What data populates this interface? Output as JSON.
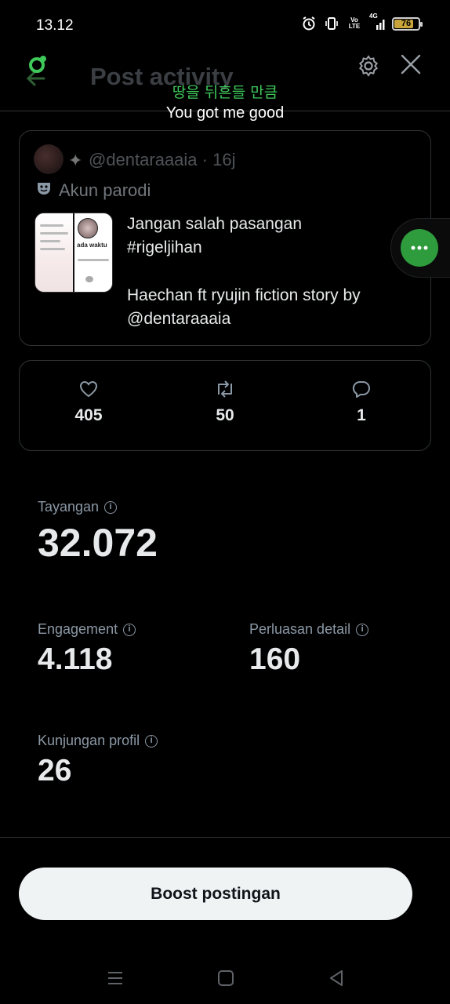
{
  "status_bar": {
    "time": "13.12",
    "volte_label": "Vo\nLTE",
    "network_label": "4G",
    "battery_level": "76",
    "battery_fraction": 0.76
  },
  "header": {
    "title": "Post activity"
  },
  "lyrics": {
    "korean": "땅을 뒤흔들 만큼",
    "english": "You got me good"
  },
  "post": {
    "handle": "@dentaraaaia · 16j",
    "parody_label": "Akun parodi",
    "text_line1": "Jangan salah pasangan",
    "text_line2": "#rigeljihan",
    "text_line3": "Haechan ft ryujin fiction story by",
    "text_line4": "@dentaraaaia",
    "thumbnail_caption": "ada waktu"
  },
  "engagement": {
    "likes": "405",
    "reposts": "50",
    "replies": "1"
  },
  "metrics": {
    "impressions_label": "Tayangan",
    "impressions_value": "32.072",
    "engagement_label": "Engagement",
    "engagement_value": "4.118",
    "detail_label": "Perluasan detail",
    "detail_value": "160",
    "profile_label": "Kunjungan profil",
    "profile_value": "26"
  },
  "boost_button": {
    "label": "Boost postingan"
  },
  "colors": {
    "background": "#000000",
    "accent_green": "#3ec95a",
    "border": "#2f3336",
    "muted_text": "#8b98a5"
  }
}
